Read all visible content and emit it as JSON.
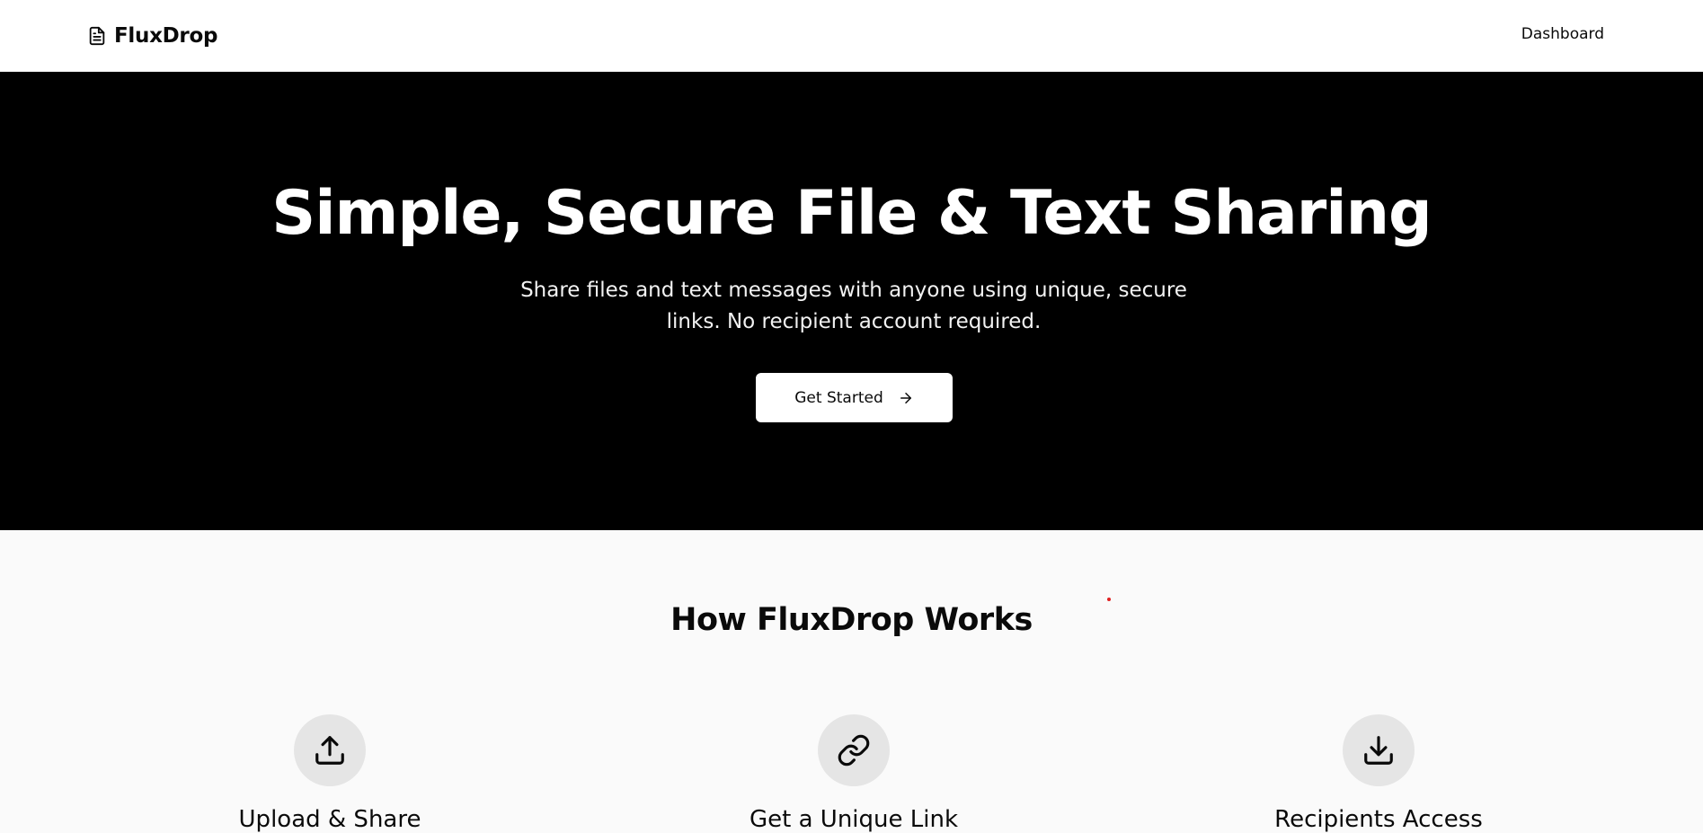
{
  "header": {
    "brand_name": "FluxDrop",
    "brand_icon": "file-text-icon",
    "nav_dashboard": "Dashboard"
  },
  "hero": {
    "title": "Simple, Secure File & Text Sharing",
    "subtitle": "Share files and text messages with anyone using unique, secure links. No recipient account required.",
    "cta_label": "Get Started",
    "cta_icon": "arrow-right-icon"
  },
  "how_it_works": {
    "title": "How FluxDrop Works",
    "steps": [
      {
        "icon": "upload-icon",
        "title": "Upload & Share"
      },
      {
        "icon": "link-icon",
        "title": "Get a Unique Link"
      },
      {
        "icon": "download-icon",
        "title": "Recipients Access"
      }
    ]
  },
  "colors": {
    "hero_bg": "#000000",
    "page_bg": "#fafafa",
    "icon_circle_bg": "#e5e5e5",
    "accent_dot": "#e02020"
  }
}
